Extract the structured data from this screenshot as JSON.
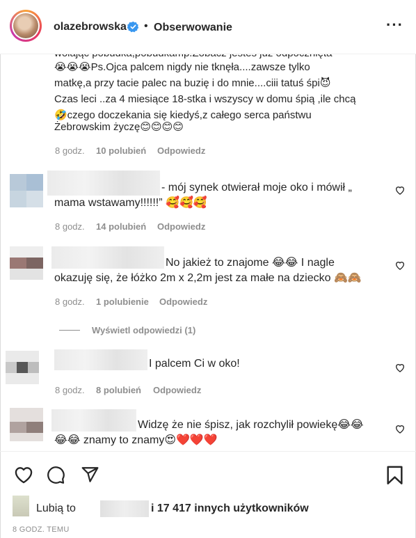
{
  "header": {
    "username": "olazebrowska",
    "separator": "•",
    "follow_label": "Obserwowanie",
    "more_label": "···"
  },
  "comments": [
    {
      "lines": [
        "wolając  pobudka,pobudkamp.Zobacz jesteś już  odpocznięta",
        "😭😭😭Ps.Ojca palcem nigdy nie tknęła....zawsze tylko",
        "matkę,a przy tacie palec na buzię i do mnie....ciii tatuś śpi😈",
        "Czas leci ..za 4 miesiące 18-stka i wszyscy w domu śpią ,ile chcą",
        "🤣czego doczekania się kiedyś,z całego serca państwu",
        "Żebrowskim życzę😊😊😊😊"
      ],
      "time": "8 godz.",
      "likes": "10 polubień",
      "reply": "Odpowiedz"
    },
    {
      "lines": [
        "- mój synek otwierał moje oko i mówił „",
        "mama wstawamy!!!!!!” 🥰🥰🥰"
      ],
      "time": "8 godz.",
      "likes": "14 polubień",
      "reply": "Odpowiedz"
    },
    {
      "lines": [
        "No jakież to znajome 😂😂 I nagle",
        "okazuję się, że łóżko 2m x 2,2m jest za małe na dziecko 🙈🙈"
      ],
      "time": "8 godz.",
      "likes": "1 polubienie",
      "reply": "Odpowiedz"
    },
    {
      "lines": [
        "I palcem Ci w oko!"
      ],
      "time": "8 godz.",
      "likes": "8 polubień",
      "reply": "Odpowiedz"
    },
    {
      "lines": [
        "Widzę że nie śpisz, jak rozchylił powiekę😂😂",
        "😂😂 znamy to znamy😍❤️❤️❤️"
      ]
    }
  ],
  "view_replies": "Wyświetl odpowiedzi (1)",
  "footer": {
    "likes_prefix": "Lubią to",
    "likes_suffix": "i 17 417 innych użytkowników",
    "time": "8 GODZ. TEMU"
  },
  "icons": {
    "verified": "verified-badge-icon",
    "heart": "heart-outline-icon",
    "comment": "comment-bubble-icon",
    "share": "paper-plane-icon",
    "save": "bookmark-icon",
    "more": "more-dots-icon"
  },
  "colors": {
    "text": "#262626",
    "muted": "#8e8e8e",
    "verified": "#3897f0",
    "divider": "#efefef"
  }
}
